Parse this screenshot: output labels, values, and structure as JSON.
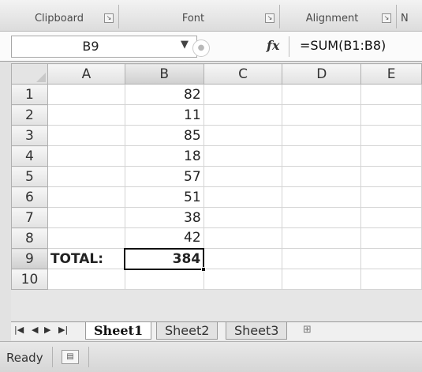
{
  "ribbon": {
    "groups": [
      "Clipboard",
      "Font",
      "Alignment",
      "N"
    ]
  },
  "formula_bar": {
    "name_box": "B9",
    "fx_label": "fx",
    "formula": "=SUM(B1:B8)"
  },
  "columns": [
    "A",
    "B",
    "C",
    "D",
    "E"
  ],
  "rows": [
    {
      "num": "1",
      "a": "",
      "b": "82"
    },
    {
      "num": "2",
      "a": "",
      "b": "11"
    },
    {
      "num": "3",
      "a": "",
      "b": "85"
    },
    {
      "num": "4",
      "a": "",
      "b": "18"
    },
    {
      "num": "5",
      "a": "",
      "b": "57"
    },
    {
      "num": "6",
      "a": "",
      "b": "51"
    },
    {
      "num": "7",
      "a": "",
      "b": "38"
    },
    {
      "num": "8",
      "a": "",
      "b": "42"
    },
    {
      "num": "9",
      "a": "TOTAL:",
      "b": "384"
    },
    {
      "num": "10",
      "a": "",
      "b": ""
    }
  ],
  "sheets": [
    "Sheet1",
    "Sheet2",
    "Sheet3"
  ],
  "active_sheet": "Sheet1",
  "status": {
    "text": "Ready"
  }
}
